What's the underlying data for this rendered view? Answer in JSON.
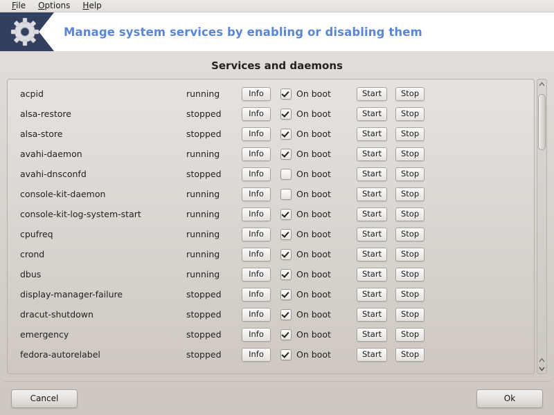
{
  "menubar": {
    "items": [
      {
        "accel": "F",
        "rest": "ile"
      },
      {
        "accel": "O",
        "rest": "ptions"
      },
      {
        "accel": "H",
        "rest": "elp"
      }
    ]
  },
  "banner": {
    "title": "Manage system services by enabling or disabling them",
    "icon": "gear-icon",
    "badge_color": "#333f5e",
    "title_color": "#5b86d1"
  },
  "section": {
    "title": "Services and daemons"
  },
  "list": {
    "columns": [
      "service",
      "status",
      "info",
      "on_boot",
      "start",
      "stop"
    ],
    "labels": {
      "info": "Info",
      "on_boot": "On boot",
      "start": "Start",
      "stop": "Stop"
    },
    "rows": [
      {
        "name": "acpid",
        "status": "running",
        "on_boot": true
      },
      {
        "name": "alsa-restore",
        "status": "stopped",
        "on_boot": true
      },
      {
        "name": "alsa-store",
        "status": "stopped",
        "on_boot": true
      },
      {
        "name": "avahi-daemon",
        "status": "running",
        "on_boot": true
      },
      {
        "name": "avahi-dnsconfd",
        "status": "stopped",
        "on_boot": false
      },
      {
        "name": "console-kit-daemon",
        "status": "running",
        "on_boot": false
      },
      {
        "name": "console-kit-log-system-start",
        "status": "running",
        "on_boot": true
      },
      {
        "name": "cpufreq",
        "status": "running",
        "on_boot": true
      },
      {
        "name": "crond",
        "status": "running",
        "on_boot": true
      },
      {
        "name": "dbus",
        "status": "running",
        "on_boot": true
      },
      {
        "name": "display-manager-failure",
        "status": "stopped",
        "on_boot": true
      },
      {
        "name": "dracut-shutdown",
        "status": "stopped",
        "on_boot": true
      },
      {
        "name": "emergency",
        "status": "stopped",
        "on_boot": true
      },
      {
        "name": "fedora-autorelabel",
        "status": "stopped",
        "on_boot": true
      }
    ]
  },
  "scrollbar": {
    "up_arrow": "chevron-up-icon",
    "down_arrow": "chevron-down-icon",
    "thumb_position_percent": 2,
    "thumb_size_percent": 21
  },
  "footer": {
    "cancel_label": "Cancel",
    "ok_label": "Ok"
  }
}
